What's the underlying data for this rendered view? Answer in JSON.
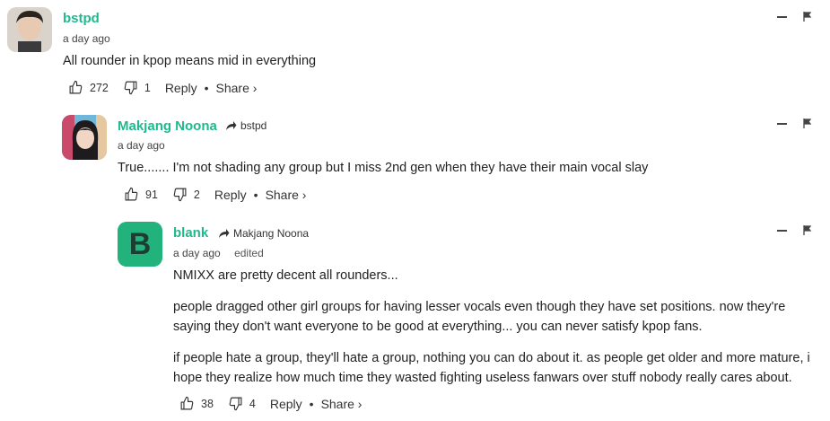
{
  "comments": [
    {
      "author": "bstpd",
      "reply_to": "",
      "time": "a day ago",
      "edited": "",
      "paragraphs": [
        "All rounder in kpop means mid in everything"
      ],
      "likes": "272",
      "dislikes": "1",
      "reply_label": "Reply",
      "share_label": "Share ›"
    },
    {
      "author": "Makjang Noona",
      "reply_to": "bstpd",
      "time": "a day ago",
      "edited": "",
      "paragraphs": [
        "True....... I'm not shading any group but I miss 2nd gen when they have their main vocal slay"
      ],
      "likes": "91",
      "dislikes": "2",
      "reply_label": "Reply",
      "share_label": "Share ›"
    },
    {
      "author": "blank",
      "reply_to": "Makjang Noona",
      "time": "a day ago",
      "edited": "edited",
      "avatar_letter": "B",
      "paragraphs": [
        "NMIXX are pretty decent all rounders...",
        "people dragged other girl groups for having lesser vocals even though they have set positions. now they're\nsaying they don't want everyone to be good at everything... you can never satisfy kpop fans.",
        "if people hate a group, they'll hate a group, nothing you can do about it. as people get older and more mature, i\nhope they realize how much time they wasted fighting useless fanwars over stuff nobody really cares about."
      ],
      "likes": "38",
      "dislikes": "4",
      "reply_label": "Reply",
      "share_label": "Share ›"
    }
  ],
  "colors": {
    "accent": "#1fb98e",
    "letter_avatar_bg": "#22b37d"
  },
  "icons": [
    "thumbs-up-icon",
    "thumbs-down-icon",
    "reply-arrow-icon",
    "flag-icon",
    "collapse-icon"
  ]
}
